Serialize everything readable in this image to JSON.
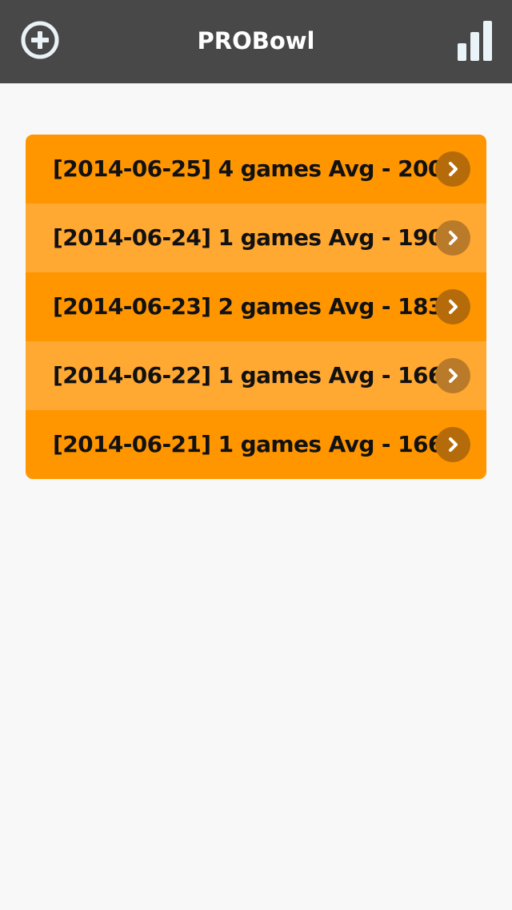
{
  "header": {
    "title": "PROBowl",
    "add_icon": "plus-circle-icon",
    "stats_icon": "bar-chart-icon"
  },
  "sessions": [
    {
      "label": "[2014-06-25] 4 games Avg - 200"
    },
    {
      "label": "[2014-06-24] 1 games Avg - 190"
    },
    {
      "label": "[2014-06-23] 2 games Avg - 183"
    },
    {
      "label": "[2014-06-22] 1 games Avg - 166"
    },
    {
      "label": "[2014-06-21] 1 games Avg - 166"
    }
  ],
  "colors": {
    "header_bg": "#484848",
    "row_primary": "#ff9600",
    "row_alt": "#ffa832",
    "page_bg": "#f8f8f8"
  }
}
